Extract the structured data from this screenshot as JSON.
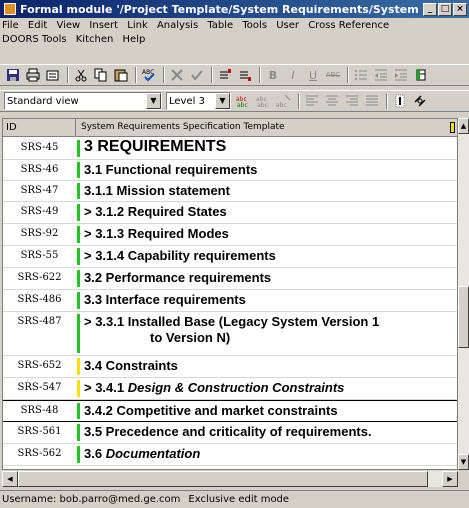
{
  "window": {
    "title": "Formal module '/Project Template/System Requirements/System Requ...",
    "min": "_",
    "max": "□",
    "close": "×"
  },
  "menu": [
    "File",
    "Edit",
    "View",
    "Insert",
    "Link",
    "Analysis",
    "Table",
    "Tools",
    "User",
    "Cross Reference",
    "DOORS Tools",
    "Kitchen",
    "Help"
  ],
  "toolbar2": {
    "view_value": "Standard view",
    "level_value": "Level 3"
  },
  "grid": {
    "header": {
      "id": "ID",
      "main": "System Requirements Specification Template"
    },
    "rows": [
      {
        "id": "SRS-45",
        "text": "3 REQUIREMENTS"
      },
      {
        "id": "SRS-46",
        "text": "3.1 Functional requirements"
      },
      {
        "id": "SRS-47",
        "text": "3.1.1 Mission statement"
      },
      {
        "id": "SRS-49",
        "text": "> 3.1.2 Required States"
      },
      {
        "id": "SRS-92",
        "text": "> 3.1.3 Required Modes"
      },
      {
        "id": "SRS-55",
        "text": "> 3.1.4 Capability requirements"
      },
      {
        "id": "SRS-622",
        "text": "3.2 Performance requirements"
      },
      {
        "id": "SRS-486",
        "text": "3.3 Interface requirements"
      },
      {
        "id": "SRS-487",
        "text": "> 3.3.1 Installed Base (Legacy System Version 1",
        "text2": "to Version N)"
      },
      {
        "id": "SRS-652",
        "text": "3.4 Constraints"
      },
      {
        "id": "SRS-547",
        "text_plain": "> 3.4.1 ",
        "text_italic": "Design & Construction Constraints"
      },
      {
        "id": "SRS-48",
        "text": "3.4.2 Competitive and market constraints"
      },
      {
        "id": "SRS-561",
        "text": "3.5 Precedence and criticality of requirements."
      },
      {
        "id": "SRS-562",
        "text_plain": "3.6 ",
        "text_italic": "Documentation"
      }
    ]
  },
  "status": {
    "username": "Username: bob.parro@med.ge.com",
    "mode": "Exclusive edit mode"
  },
  "colors": {
    "title_bar": "#0a246a",
    "bar_green": "#22c322",
    "bar_yellow": "#ffe000"
  }
}
